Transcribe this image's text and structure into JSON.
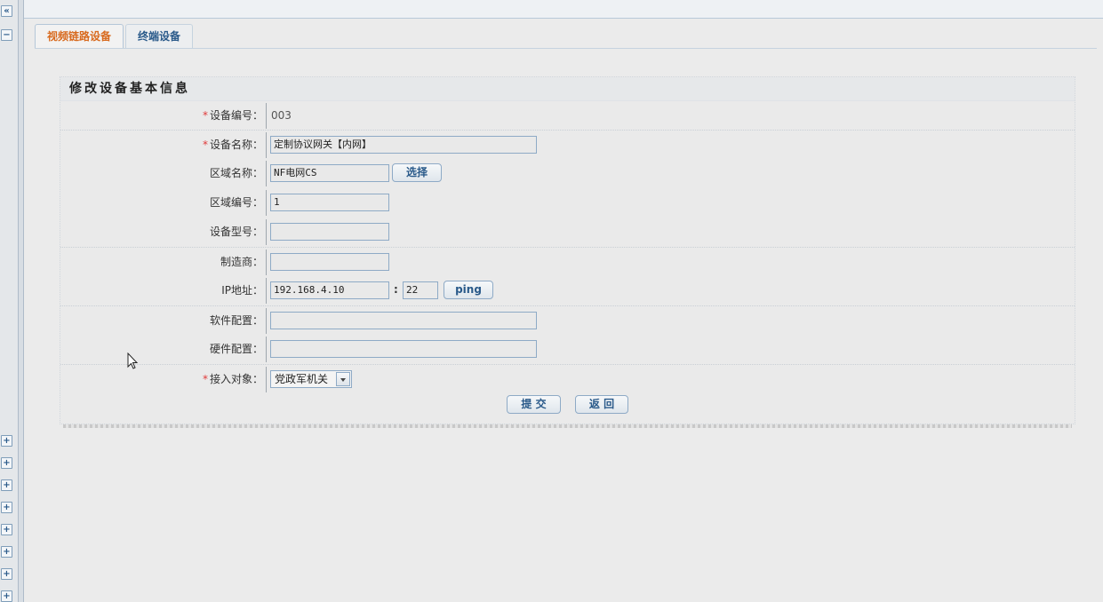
{
  "sidebar": {
    "collapse_icon": "«",
    "minus_icon": "−",
    "plus_icon": "+"
  },
  "tabs": [
    {
      "label": "视频链路设备",
      "active": true
    },
    {
      "label": "终端设备",
      "active": false
    }
  ],
  "form": {
    "title": "修改设备基本信息",
    "required_mark": "*",
    "fields": {
      "device_no": {
        "label": "设备编号：",
        "value": "003"
      },
      "device_name": {
        "label": "设备名称：",
        "value": "定制协议网关【内网】"
      },
      "area_name": {
        "label": "区域名称：",
        "value": "NF电网CS",
        "button": "选择"
      },
      "area_no": {
        "label": "区域编号：",
        "value": "1"
      },
      "device_model": {
        "label": "设备型号：",
        "value": ""
      },
      "manufacturer": {
        "label": "制造商：",
        "value": ""
      },
      "ip": {
        "label": "IP地址：",
        "value": "192.168.4.10",
        "separator": ":",
        "port": "22",
        "button": "ping"
      },
      "software": {
        "label": "软件配置：",
        "value": ""
      },
      "hardware": {
        "label": "硬件配置：",
        "value": ""
      },
      "access_target": {
        "label": "接入对象：",
        "value": "党政军机关"
      }
    },
    "submit_label": "提 交",
    "back_label": "返 回"
  },
  "colors": {
    "active_tab": "#d86a1e",
    "tab_text": "#2a5a8a",
    "required": "#e03a3a",
    "input_border": "#8eaac6"
  }
}
